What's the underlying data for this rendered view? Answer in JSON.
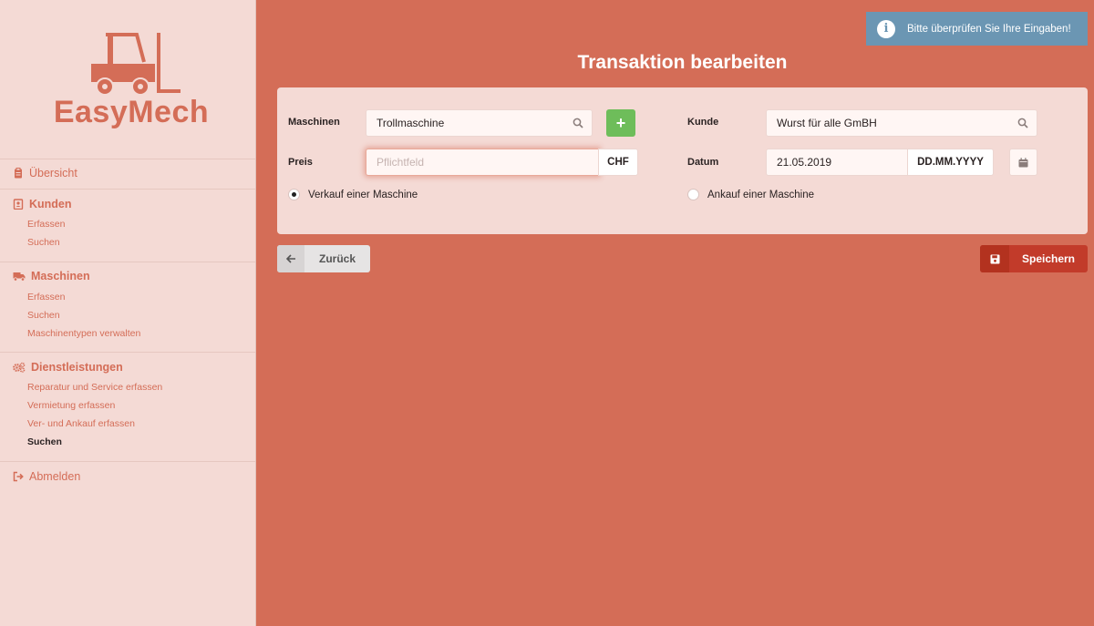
{
  "brand": {
    "name": "EasyMech"
  },
  "sidebar": {
    "overview": "Übersicht",
    "kunden": {
      "label": "Kunden",
      "items": [
        "Erfassen",
        "Suchen"
      ]
    },
    "maschinen": {
      "label": "Maschinen",
      "items": [
        "Erfassen",
        "Suchen",
        "Maschinentypen verwalten"
      ]
    },
    "dienst": {
      "label": "Dienstleistungen",
      "items": [
        "Reparatur und Service erfassen",
        "Vermietung erfassen",
        "Ver- und Ankauf erfassen",
        "Suchen"
      ]
    },
    "logout": "Abmelden"
  },
  "toast": {
    "message": "Bitte überprüfen Sie Ihre Eingaben!",
    "icon": "info-icon"
  },
  "page": {
    "title": "Transaktion bearbeiten"
  },
  "form": {
    "maschinen_label": "Maschinen",
    "maschinen_value": "Trollmaschine",
    "preis_label": "Preis",
    "preis_placeholder": "Pflichtfeld",
    "currency": "CHF",
    "kunde_label": "Kunde",
    "kunde_value": "Wurst für alle GmBH",
    "datum_label": "Datum",
    "datum_value": "21.05.2019",
    "datum_format": "DD.MM.YYYY",
    "radio_sale": "Verkauf einer Maschine",
    "radio_purchase": "Ankauf einer Maschine",
    "selected": "sale"
  },
  "actions": {
    "back": "Zurück",
    "save": "Speichern"
  },
  "colors": {
    "accent": "#d46d57",
    "sidebar_bg": "#f4dad5",
    "save": "#c23b2a",
    "add": "#6ebd5a",
    "toast": "#6b96b3"
  }
}
